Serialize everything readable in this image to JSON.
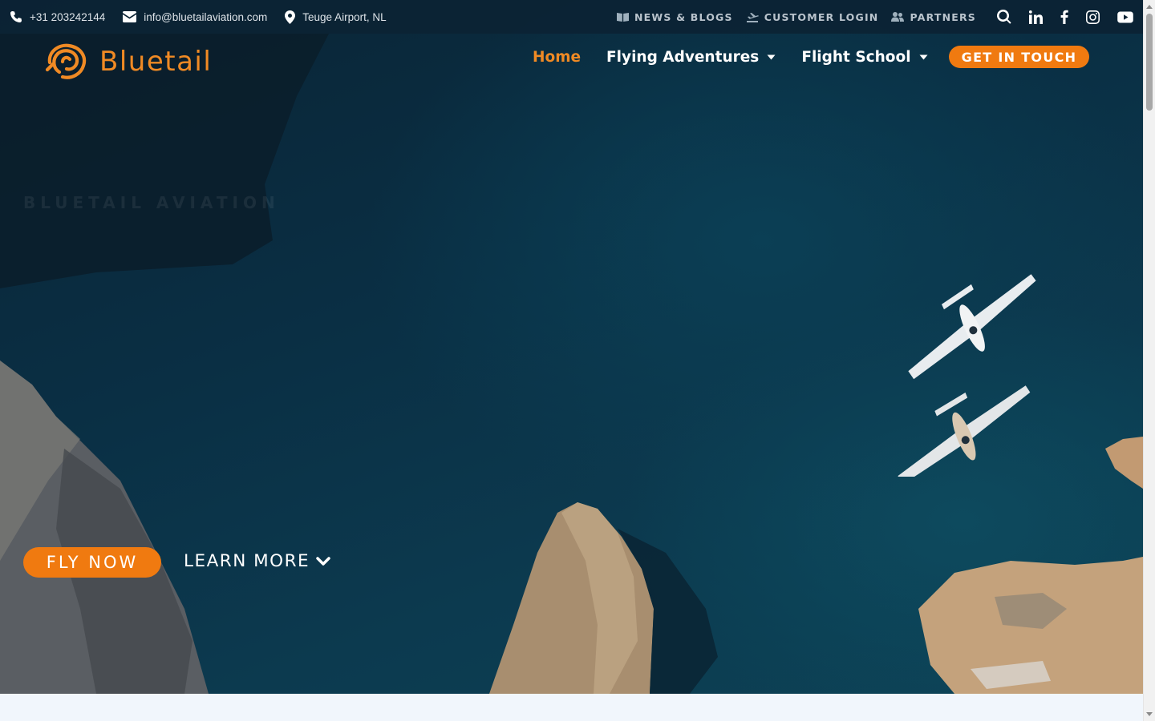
{
  "topbar": {
    "phone": "+31 203242144",
    "email": "info@bluetailaviation.com",
    "location": "Teuge Airport, NL",
    "links": [
      {
        "label": "NEWS & BLOGS",
        "icon": "book-icon"
      },
      {
        "label": "CUSTOMER LOGIN",
        "icon": "plane-departure-icon"
      },
      {
        "label": "PARTNERS",
        "icon": "users-icon"
      }
    ],
    "social_icons": [
      "search-icon",
      "linkedin-icon",
      "facebook-icon",
      "instagram-icon",
      "youtube-icon"
    ]
  },
  "logo": {
    "text": "Bluetail"
  },
  "nav": {
    "items": [
      {
        "label": "Home",
        "active": true
      },
      {
        "label": "Flying Adventures",
        "dropdown": true
      },
      {
        "label": "Flight School",
        "dropdown": true
      }
    ],
    "cta": "GET IN TOUCH"
  },
  "hero": {
    "kicker": "BLUETAIL AVIATION",
    "primary_button": "FLY NOW",
    "secondary_button": "LEARN MORE"
  },
  "colors": {
    "accent": "#f07a10",
    "logo_orange": "#f08a24",
    "topbar_bg": "#0c2334"
  }
}
